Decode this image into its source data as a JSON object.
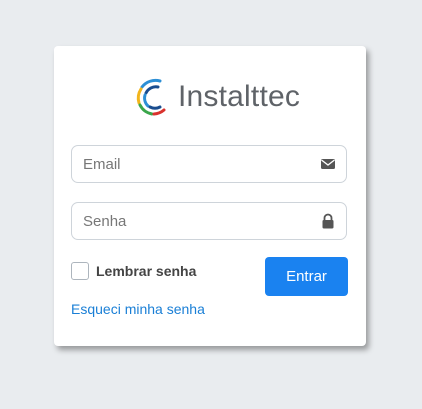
{
  "brand": {
    "name": "Instalttec",
    "logo_icon": "c-ring-logo-icon"
  },
  "form": {
    "email": {
      "placeholder": "Email",
      "value": "",
      "icon": "envelope-icon"
    },
    "password": {
      "placeholder": "Senha",
      "value": "",
      "icon": "lock-icon"
    },
    "remember": {
      "label": "Lembrar senha",
      "checked": false
    },
    "submit_label": "Entrar",
    "forgot_label": "Esqueci minha senha"
  },
  "colors": {
    "background": "#e9ecef",
    "card": "#ffffff",
    "primary": "#1a82f0",
    "link": "#1a7fd6",
    "icon": "#555555"
  }
}
